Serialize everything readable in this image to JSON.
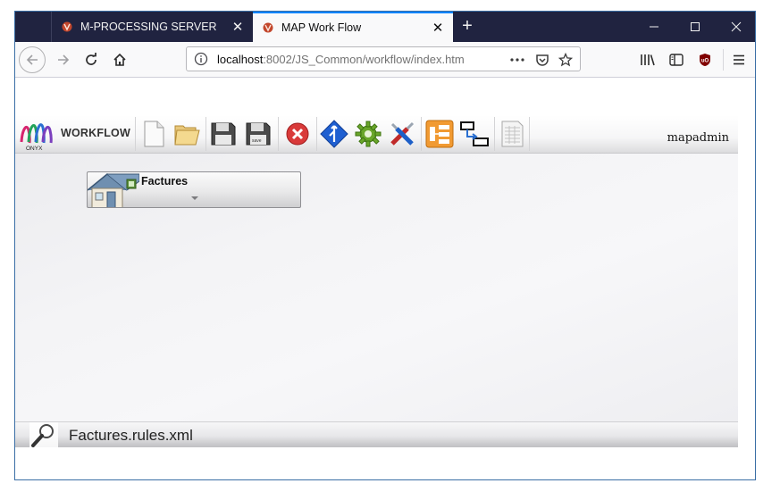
{
  "browser": {
    "tabs": [
      {
        "title": "M-PROCESSING SERVER",
        "active": false
      },
      {
        "title": "MAP Work Flow",
        "active": true
      }
    ],
    "url_host": "localhost",
    "url_rest": ":8002/JS_Common/workflow/index.htm",
    "accent": "#0a84ff",
    "tabstrip_color": "#202340"
  },
  "app": {
    "logo_caption": "ONYX",
    "logo_word": "WORKFLOW",
    "user": "mapadmin",
    "toolbar_icons": [
      "new-document-icon",
      "open-folder-icon",
      "save-icon",
      "save-as-icon",
      "delete-icon",
      "route-icon",
      "settings-gear-icon",
      "tools-icon",
      "flow-chart-icon",
      "link-blocks-icon",
      "report-icon"
    ]
  },
  "workflow": {
    "node_title": "Factures",
    "status_file": "Factures.rules.xml"
  }
}
